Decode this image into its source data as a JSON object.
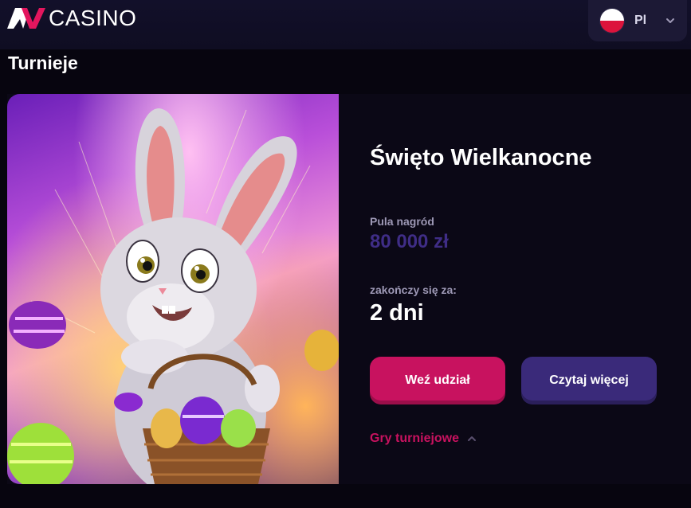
{
  "header": {
    "logo_text": "CASINO",
    "language": {
      "code": "Pl",
      "flag": "poland-flag-icon"
    }
  },
  "page_title": "Turnieje",
  "tournament": {
    "title": "Święto Wielkanocne",
    "prize_label": "Pula nagród",
    "prize_value": "80 000 zł",
    "ends_label": "zakończy się za:",
    "ends_value": "2 dni",
    "join_button": "Weź udział",
    "read_more_button": "Czytaj więcej",
    "games_link": "Gry turniejowe",
    "banner_image": "easter-bunny-illustration"
  },
  "colors": {
    "background": "#07050f",
    "header": "#12102a",
    "accent_pink": "#c8125f",
    "accent_purple": "#3a2a7a",
    "prize_text": "#3f2d86",
    "muted_label": "#9d98b5"
  }
}
